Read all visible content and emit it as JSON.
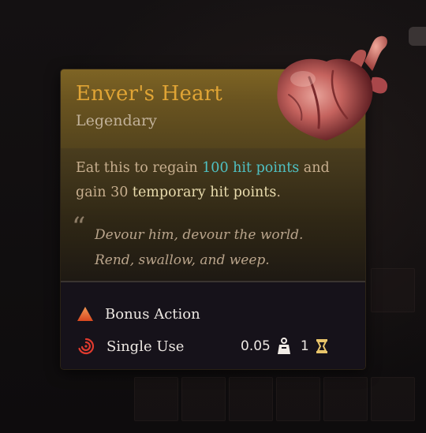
{
  "item": {
    "name": "Enver's Heart",
    "rarity": "Legendary",
    "name_color": "#e0a435"
  },
  "description": {
    "part1": "Eat this to regain ",
    "heal_amount": "100 hit points",
    "part2": " and gain 30 ",
    "temp_hp": "temporary hit points",
    "part3": "."
  },
  "flavor": {
    "quote_mark": "“",
    "line1": "Devour him, devour the world.",
    "line2": "Rend, swallow, and weep."
  },
  "footer": {
    "action_type": {
      "label": "Bonus Action",
      "icon": "bonus-action-triangle-icon",
      "color": "#e8622a"
    },
    "usage": {
      "label": "Single Use",
      "icon": "single-use-swirl-icon",
      "color": "#e03a2e"
    },
    "weight": {
      "value": "0.05",
      "icon": "weight-icon"
    },
    "gold_value": {
      "value": "1",
      "icon": "gold-value-icon",
      "color": "#e8c46a"
    }
  },
  "image": {
    "icon": "heart-item-icon"
  }
}
